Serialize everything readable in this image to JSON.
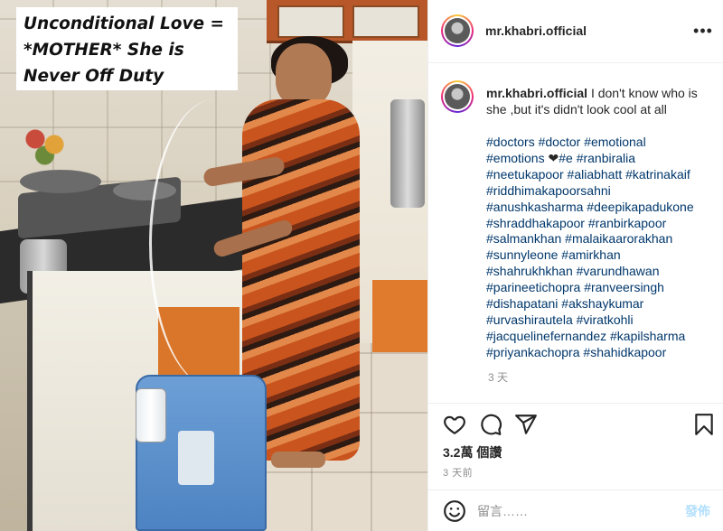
{
  "photo": {
    "caption_lines": [
      "Unconditional Love =",
      "*MOTHER* She is",
      "Never Off Duty"
    ]
  },
  "header": {
    "username": "mr.khabri.official",
    "more_icon": "more-horizontal-icon",
    "more_label": "•••"
  },
  "caption": {
    "username": "mr.khabri.official",
    "text": "I don't know who is she ,but it's didn't look cool at all",
    "hashtag_lines": [
      [
        "#doctors",
        "#doctor",
        "#emotional"
      ],
      [
        "#emotions",
        "❤",
        "#e",
        "#ranbiralia"
      ],
      [
        "#neetukapoor",
        "#aliabhatt",
        "#katrinakaif"
      ],
      [
        "#riddhimakapoorsahni"
      ],
      [
        "#anushkasharma",
        "#deepikapadukone"
      ],
      [
        "#shraddhakapoor",
        "#ranbirkapoor"
      ],
      [
        "#salmankhan",
        "#malaikaarorakhan"
      ],
      [
        "#sunnyleone",
        "#amirkhan"
      ],
      [
        "#shahrukhkhan",
        "#varundhawan"
      ],
      [
        "#parineetichopra",
        "#ranveersingh"
      ],
      [
        "#dishapatani",
        "#akshaykumar"
      ],
      [
        "#urvashirautela",
        "#viratkohli"
      ],
      [
        "#jacquelinefernandez",
        "#kapilsharma"
      ],
      [
        "#priyankachopra",
        "#shahidkapoor"
      ]
    ],
    "time": "3 天"
  },
  "actions": {
    "like_icon": "heart-icon",
    "comment_icon": "comment-bubble-icon",
    "share_icon": "paper-plane-icon",
    "save_icon": "bookmark-icon",
    "likes_text": "3.2萬 個讚",
    "post_time": "3 天前"
  },
  "add_comment": {
    "emoji_icon": "smiley-icon",
    "placeholder": "留言……",
    "post_label": "發佈"
  },
  "colors": {
    "link": "#00376b",
    "text": "#262626",
    "muted": "#8e8e8e",
    "post_disabled": "#b2dffc",
    "border": "#efefef"
  }
}
